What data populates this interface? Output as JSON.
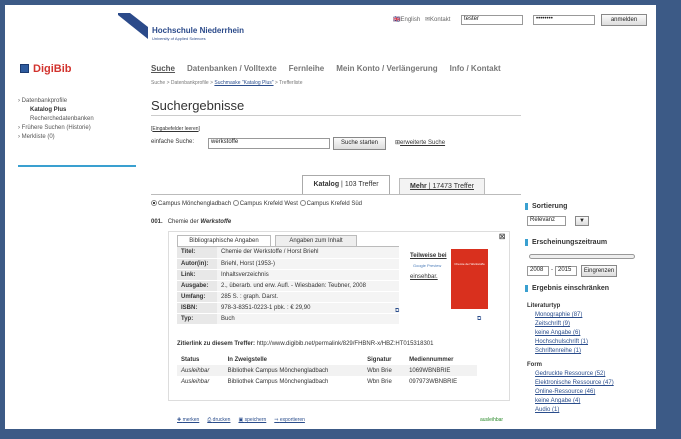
{
  "header": {
    "uni_name": "Hochschule Niederrhein",
    "uni_sub": "University of Applied Sciences",
    "lang": "English",
    "kontakt": "Kontakt",
    "username": "tester",
    "password": "••••••••",
    "login": "anmelden"
  },
  "sidebar": {
    "brand": "DigiBib",
    "items": [
      {
        "label": "Datenbankprofile"
      },
      {
        "label": "Katalog Plus"
      },
      {
        "label": "Recherchedatenbanken"
      },
      {
        "label": "Frühere Suchen (Historie)"
      },
      {
        "label": "Merkliste (0)"
      }
    ]
  },
  "nav": {
    "items": [
      "Suche",
      "Datenbanken / Volltexte",
      "Fernleihe",
      "Mein Konto / Verlängerung",
      "Info / Kontakt"
    ]
  },
  "breadcrumb": {
    "a": "Suche > Datenbankprofile > ",
    "b": "Suchmaske \"Katalog Plus\"",
    "c": " > Trefferliste"
  },
  "title": "Suchergebnisse",
  "search": {
    "clear": "Eingabefelder leeren",
    "label": "einfache Suche:",
    "value": "werkstoffe",
    "button": "Suche starten",
    "advanced": "erweiterte Suche"
  },
  "tabs": {
    "katalog": "Katalog",
    "katalog_hits": "103 Treffer",
    "mehr": "Mehr",
    "mehr_hits": "17473 Treffer"
  },
  "campus": [
    "Campus Mönchengladbach",
    "Campus Krefeld West",
    "Campus Krefeld Süd"
  ],
  "result": {
    "num": "001.",
    "title_pre": "Chemie der ",
    "title_em": "Werkstoffe"
  },
  "detail": {
    "tab1": "Bibliographische Angaben",
    "tab2": "Angaben zum Inhalt",
    "rows": [
      {
        "k": "Titel:",
        "v": "Chemie der Werkstoffe / Horst Briehl"
      },
      {
        "k": "Autor(in):",
        "v": "Briehl, Horst (1953-)"
      },
      {
        "k": "Link:",
        "v": "Inhaltsverzeichnis"
      },
      {
        "k": "Ausgabe:",
        "v": "2., überarb. und erw. Aufl. - Wiesbaden: Teubner, 2008"
      },
      {
        "k": "Umfang:",
        "v": "285 S. : graph. Darst."
      },
      {
        "k": "ISBN:",
        "v": "978-3-8351-0223-1 pbk. : € 29,90"
      },
      {
        "k": "Typ:",
        "v": "Buch"
      }
    ],
    "gb1": "Teilweise bei",
    "gb_logo": "Google Preview",
    "gb2": "einsehbar.",
    "cover_title": "Chemie der Werkstoffe",
    "perma_label": "Zitierlink zu diesem Treffer:",
    "perma_url": "http://www.digibib.net/permalink/829/FHBNR-x/HBZ:HT015318301"
  },
  "holdings": {
    "headers": [
      "Status",
      "In Zweigstelle",
      "Signatur",
      "Mediennummer"
    ],
    "rows": [
      [
        "Ausleihbar",
        "Bibliothek Campus Mönchengladbach",
        "Wbn Brie",
        "1069WBNBRIE"
      ],
      [
        "Ausleihbar",
        "Bibliothek Campus Mönchengladbach",
        "Wbn Brie",
        "097973WBNBRIE"
      ]
    ]
  },
  "footer": {
    "merken": "merken",
    "drucken": "drucken",
    "speichern": "speichern",
    "exportieren": "exportieren",
    "status": "ausleihbar"
  },
  "facets": {
    "sort_h": "Sortierung",
    "sort_val": "Relevanz",
    "year_h": "Erscheinungszeitraum",
    "from": "2008",
    "to": "2015",
    "eingrenzen": "Eingrenzen",
    "refine_h": "Ergebnis einschränken",
    "groups": [
      {
        "name": "Literaturtyp",
        "items": [
          "Monographie (87)",
          "Zeitschrift (9)",
          "keine Angabe (6)",
          "Hochschulschrift (1)",
          "Schriftenreihe (1)"
        ]
      },
      {
        "name": "Form",
        "items": [
          "Gedruckte Ressource (52)",
          "Elektronische Ressource (47)",
          "Online-Ressource (46)",
          "keine Angabe (4)",
          "Audio (1)"
        ]
      }
    ]
  },
  "colors": {
    "frame": "#3c5a86",
    "accent": "#3aa0d0",
    "brand_red": "#d2332e"
  }
}
